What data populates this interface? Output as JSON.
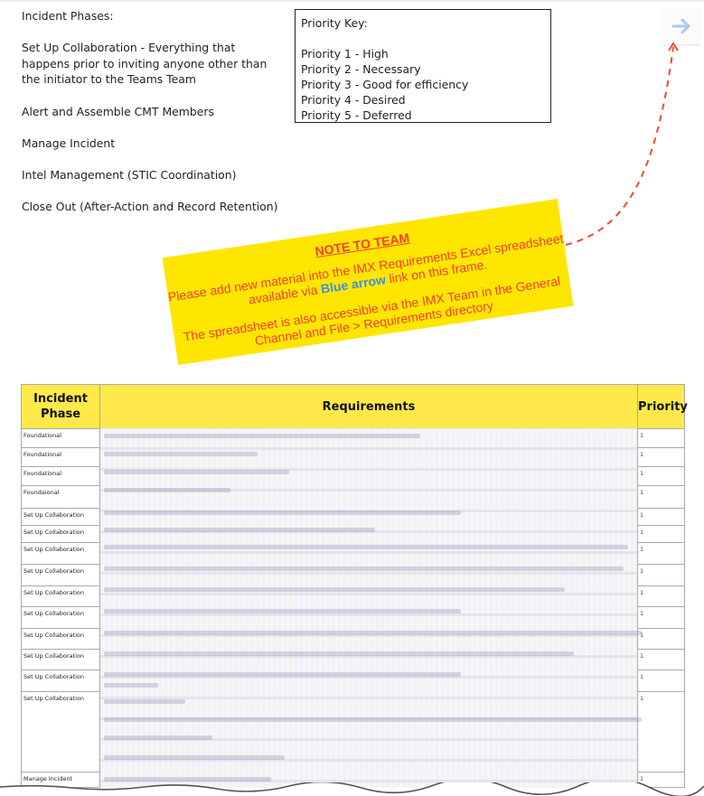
{
  "phases_text": {
    "heading": "Incident Phases:",
    "items": [
      "Set Up Collaboration - Everything that happens prior to inviting anyone other than the initiator to the Teams Team",
      "Alert and Assemble CMT Members",
      "Manage Incident",
      "Intel Management (STIC Coordination)",
      "Close Out (After-Action and Record Retention)"
    ]
  },
  "priority_key": {
    "title": "Priority Key:",
    "items": [
      "Priority 1 - High",
      "Priority 2 - Necessary",
      "Priority 3 - Good for efficiency",
      "Priority 4 - Desired",
      "Priority 5 - Deferred"
    ]
  },
  "link_button": {
    "icon": "arrow-right-icon",
    "color": "#a9c8f7"
  },
  "note": {
    "heading": "NOTE TO TEAM",
    "line1_before": "Please add new material into the IMX Requirements Excel spreadsheet available via ",
    "line1_highlight": "Blue arrow",
    "line1_after": " link on this frame.",
    "line2": "The spreadsheet is also accessible via the IMX Team in the General Channel and File > Requirements directory",
    "background": "#ffe600",
    "text_color": "#f0412b",
    "highlight_color": "#3b8fe0"
  },
  "table": {
    "headers": {
      "phase": "Incident Phase",
      "requirements": "Requirements",
      "priority": "Priority"
    },
    "header_color": "#ffe94a",
    "rows": [
      {
        "phase": "Foundational",
        "priority": "1"
      },
      {
        "phase": "Foundational",
        "priority": "1"
      },
      {
        "phase": "Foundational",
        "priority": "1"
      },
      {
        "phase": "Foundaional",
        "priority": "1"
      },
      {
        "phase": "Set Up Collaboration",
        "priority": "1"
      },
      {
        "phase": "Set Up Collaboration",
        "priority": "1"
      },
      {
        "phase": "Set Up Collaboration",
        "priority": "1"
      },
      {
        "phase": "Set Up Collaboration",
        "priority": "1"
      },
      {
        "phase": "Set Up Collaboration",
        "priority": "1"
      },
      {
        "phase": "Set Up Collaboration",
        "priority": "1"
      },
      {
        "phase": "Set Up Collaboration",
        "priority": "1"
      },
      {
        "phase": "Set Up Collaboration",
        "priority": "1"
      },
      {
        "phase": "Set Up Collaboration",
        "priority": "1"
      },
      {
        "phase": "Set Up Collaboration",
        "priority": "1"
      },
      {
        "phase": "Manage Incident",
        "priority": "1"
      }
    ]
  }
}
